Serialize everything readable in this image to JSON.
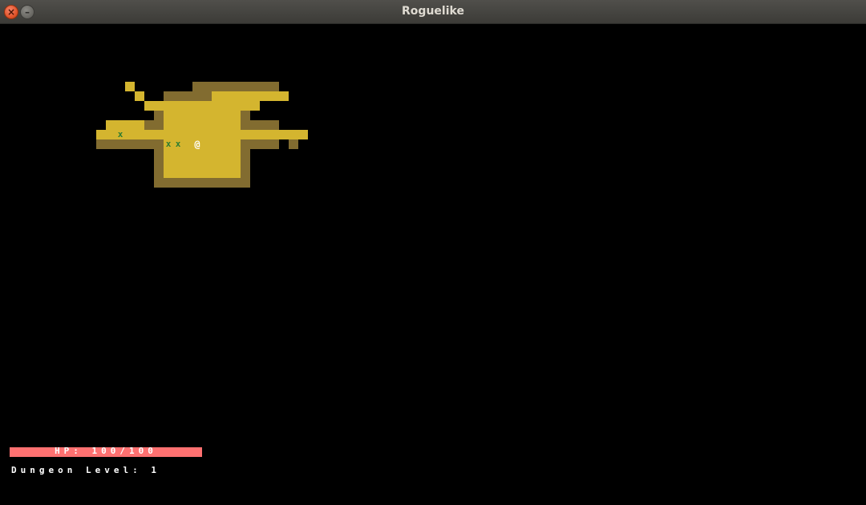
{
  "window": {
    "title": "Roguelike",
    "close_icon": "×",
    "minimize_icon": "–"
  },
  "colors": {
    "floor_lit": "#d4b52f",
    "wall_lit": "#826c30",
    "background": "#000000",
    "monster": "#2e7d32",
    "player": "#ffffff",
    "hp_bar": "#ff7171"
  },
  "player": {
    "glyph": "@",
    "label": "player"
  },
  "monsters": [
    {
      "glyph": "x"
    },
    {
      "glyph": "x"
    },
    {
      "glyph": "x"
    }
  ],
  "hud": {
    "hp_text": "HP: 100/100",
    "hp_current": 100,
    "hp_max": 100,
    "dungeon_level_text": "Dungeon Level: 1"
  }
}
